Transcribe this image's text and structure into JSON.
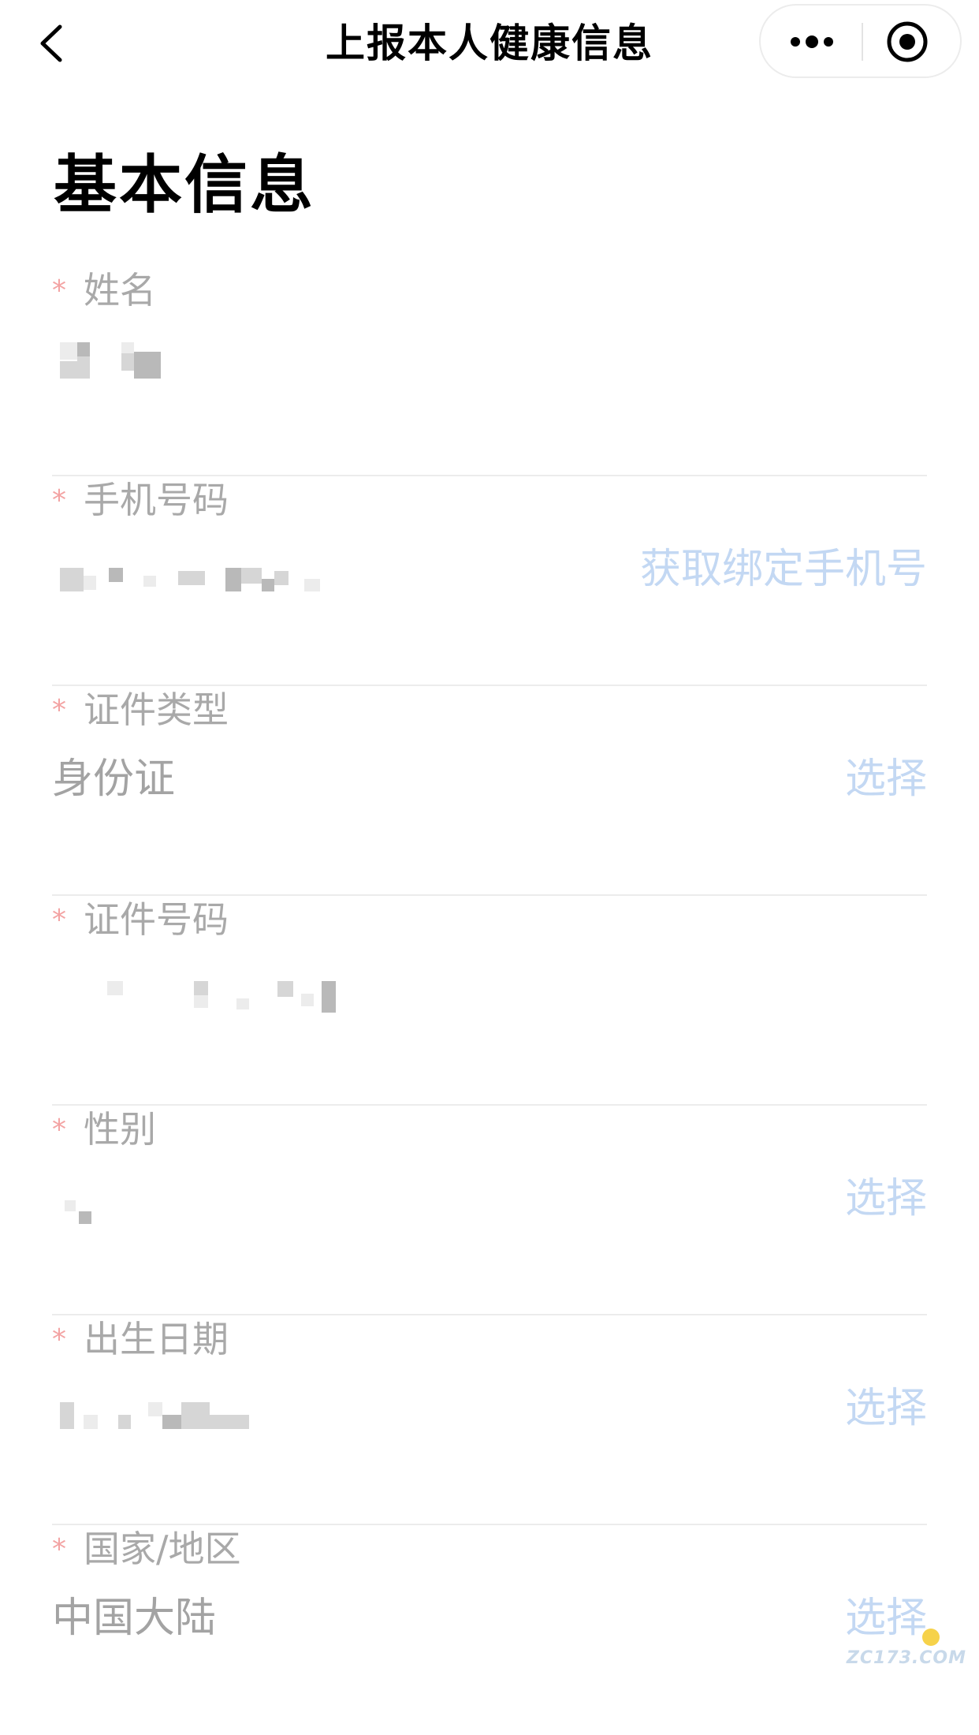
{
  "header": {
    "title": "上报本人健康信息"
  },
  "section": {
    "title": "基本信息"
  },
  "form": {
    "required_mark": "*",
    "fields": [
      {
        "label": "姓名",
        "value": "",
        "action": ""
      },
      {
        "label": "手机号码",
        "value": "",
        "action": "获取绑定手机号"
      },
      {
        "label": "证件类型",
        "value": "身份证",
        "action": "选择"
      },
      {
        "label": "证件号码",
        "value": "",
        "action": ""
      },
      {
        "label": "性别",
        "value": "",
        "action": "选择"
      },
      {
        "label": "出生日期",
        "value": "",
        "action": "选择"
      },
      {
        "label": "国家/地区",
        "value": "中国大陆",
        "action": "选择"
      }
    ]
  },
  "watermark": {
    "text": "ZC173.COM"
  },
  "colors": {
    "required": "#f3a3a3",
    "label": "#a9a9a9",
    "action": "#c3d8f3",
    "divider": "#ececec"
  }
}
